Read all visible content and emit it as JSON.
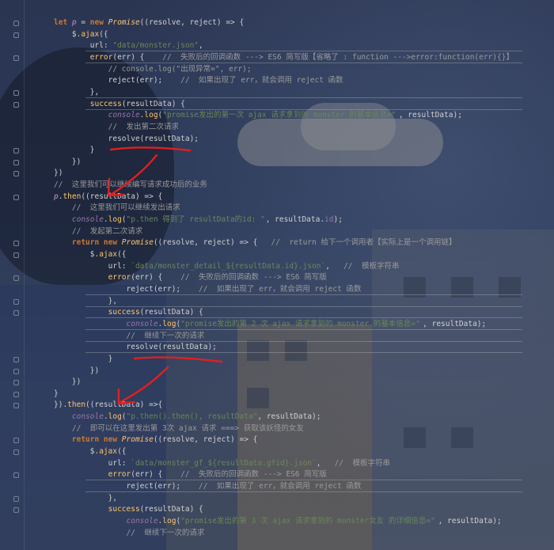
{
  "editor": {
    "lines": [
      [
        {
          "t": "let ",
          "c": "kw"
        },
        {
          "t": "p",
          "c": "var it bold"
        },
        {
          "t": " = ",
          "c": "txt"
        },
        {
          "t": "new ",
          "c": "kw"
        },
        {
          "t": "Promise",
          "c": "fn it"
        },
        {
          "t": "((resolve, reject) => {",
          "c": "txt"
        }
      ],
      [
        {
          "t": "    $",
          "c": "txt"
        },
        {
          "t": ".ajax",
          "c": "fn"
        },
        {
          "t": "({",
          "c": "txt"
        }
      ],
      [
        {
          "t": "        url: ",
          "c": "txt"
        },
        {
          "t": "\"data/monster.json\"",
          "c": "str"
        },
        {
          "t": ",",
          "c": "txt"
        }
      ],
      [
        {
          "t": "        error",
          "c": "fn"
        },
        {
          "t": "(err) {    ",
          "c": "txt"
        },
        {
          "t": "//  失败后的回调函数 ---> ES6 简写版【省略了 : function --->error:function(err){}】",
          "c": "cm"
        }
      ],
      [
        {
          "t": "            ",
          "c": "txt"
        },
        {
          "t": "// console.log(\"出现异常=\", err);",
          "c": "cm"
        }
      ],
      [
        {
          "t": "            reject(err);    ",
          "c": "txt"
        },
        {
          "t": "//  如果出现了 err，就会调用 reject 函数",
          "c": "cm"
        }
      ],
      [
        {
          "t": "        },",
          "c": "txt"
        }
      ],
      [
        {
          "t": "        success",
          "c": "fn"
        },
        {
          "t": "(resultData) {",
          "c": "txt"
        }
      ],
      [
        {
          "t": "            ",
          "c": "txt"
        },
        {
          "t": "console",
          "c": "var it"
        },
        {
          "t": ".",
          "c": "txt"
        },
        {
          "t": "log",
          "c": "fn"
        },
        {
          "t": "(",
          "c": "txt"
        },
        {
          "t": "\"promise发出的第一次 ajax 请求拿到的 monster 的基本信息=\"",
          "c": "str"
        },
        {
          "t": ", resultData);",
          "c": "txt"
        }
      ],
      [
        {
          "t": "            ",
          "c": "txt"
        },
        {
          "t": "//  发出第二次请求",
          "c": "cm"
        }
      ],
      [
        {
          "t": "            resolve(resultData);",
          "c": "txt"
        }
      ],
      [
        {
          "t": "        }",
          "c": "txt"
        }
      ],
      [
        {
          "t": "    })",
          "c": "txt"
        }
      ],
      [
        {
          "t": "})",
          "c": "txt"
        }
      ],
      [
        {
          "t": "//  这里我们可以继续编写请求成功后的业务",
          "c": "cm"
        }
      ],
      [
        {
          "t": "p",
          "c": "var it bold"
        },
        {
          "t": ".",
          "c": "txt"
        },
        {
          "t": "then",
          "c": "fn"
        },
        {
          "t": "((resultData) => {",
          "c": "txt"
        }
      ],
      [
        {
          "t": "    ",
          "c": "txt"
        },
        {
          "t": "//  这里我们可以继续发出请求",
          "c": "cm"
        }
      ],
      [
        {
          "t": "    ",
          "c": "txt"
        },
        {
          "t": "console",
          "c": "var it"
        },
        {
          "t": ".",
          "c": "txt"
        },
        {
          "t": "log",
          "c": "fn"
        },
        {
          "t": "(",
          "c": "txt"
        },
        {
          "t": "\"p.then 得到了 resultData的id: \"",
          "c": "str"
        },
        {
          "t": ", resultData.",
          "c": "txt"
        },
        {
          "t": "id",
          "c": "var"
        },
        {
          "t": ");",
          "c": "txt"
        }
      ],
      [
        {
          "t": "    ",
          "c": "txt"
        },
        {
          "t": "//  发起第二次请求",
          "c": "cm"
        }
      ],
      [
        {
          "t": "    ",
          "c": "txt"
        },
        {
          "t": "return new ",
          "c": "kw"
        },
        {
          "t": "Promise",
          "c": "fn it"
        },
        {
          "t": "((resolve, reject) => {   ",
          "c": "txt"
        },
        {
          "t": "//  return 给下一个调用者【实际上是一个调用链】",
          "c": "cm"
        }
      ],
      [
        {
          "t": "        $",
          "c": "txt"
        },
        {
          "t": ".ajax",
          "c": "fn"
        },
        {
          "t": "({",
          "c": "txt"
        }
      ],
      [
        {
          "t": "            url: ",
          "c": "txt"
        },
        {
          "t": "`data/monster_detail_${resultData.id}.json`",
          "c": "str"
        },
        {
          "t": ",   ",
          "c": "txt"
        },
        {
          "t": "//  模板字符串",
          "c": "cm"
        }
      ],
      [
        {
          "t": "            error",
          "c": "fn"
        },
        {
          "t": "(err) {    ",
          "c": "txt"
        },
        {
          "t": "//  失败后的回调函数 ---> ES6 简写版",
          "c": "cm"
        }
      ],
      [
        {
          "t": "                reject(err);    ",
          "c": "txt"
        },
        {
          "t": "//  如果出现了 err，就会调用 reject 函数",
          "c": "cm"
        }
      ],
      [
        {
          "t": "            },",
          "c": "txt"
        }
      ],
      [
        {
          "t": "            success",
          "c": "fn"
        },
        {
          "t": "(resultData) {",
          "c": "txt"
        }
      ],
      [
        {
          "t": "                ",
          "c": "txt"
        },
        {
          "t": "console",
          "c": "var it"
        },
        {
          "t": ".",
          "c": "txt"
        },
        {
          "t": "log",
          "c": "fn"
        },
        {
          "t": "(",
          "c": "txt"
        },
        {
          "t": "\"promise发出的第 2 次 ajax 请求拿到的 monster 的基本信息=\"",
          "c": "str"
        },
        {
          "t": ", resultData);",
          "c": "txt"
        }
      ],
      [
        {
          "t": "                ",
          "c": "txt"
        },
        {
          "t": "//  继续下一次的请求",
          "c": "cm"
        }
      ],
      [
        {
          "t": "                resolve(resultData);",
          "c": "txt"
        }
      ],
      [
        {
          "t": "            }",
          "c": "txt"
        }
      ],
      [
        {
          "t": "        })",
          "c": "txt"
        }
      ],
      [
        {
          "t": "    })",
          "c": "txt"
        }
      ],
      [
        {
          "t": "}",
          "c": "txt"
        }
      ],
      [
        {
          "t": "}).",
          "c": "txt"
        },
        {
          "t": "then",
          "c": "fn"
        },
        {
          "t": "((resultData) =>{",
          "c": "txt"
        }
      ],
      [
        {
          "t": "    ",
          "c": "txt"
        },
        {
          "t": "console",
          "c": "var it"
        },
        {
          "t": ".",
          "c": "txt"
        },
        {
          "t": "log",
          "c": "fn"
        },
        {
          "t": "(",
          "c": "txt"
        },
        {
          "t": "\"p.then().then(), resultData\"",
          "c": "str"
        },
        {
          "t": ", resultData);",
          "c": "txt"
        }
      ],
      [
        {
          "t": "    ",
          "c": "txt"
        },
        {
          "t": "//  即可以在这里发出第 3次 ajax 请求 ===> 获取该妖怪的女友",
          "c": "cm"
        }
      ],
      [
        {
          "t": "    ",
          "c": "txt"
        },
        {
          "t": "return new ",
          "c": "kw"
        },
        {
          "t": "Promise",
          "c": "fn it"
        },
        {
          "t": "((resolve, reject) => {",
          "c": "txt"
        }
      ],
      [
        {
          "t": "        $",
          "c": "txt"
        },
        {
          "t": ".ajax",
          "c": "fn"
        },
        {
          "t": "({",
          "c": "txt"
        }
      ],
      [
        {
          "t": "            url: ",
          "c": "txt"
        },
        {
          "t": "`data/monster_gf_${resultData.gfid}.json`",
          "c": "str"
        },
        {
          "t": ",   ",
          "c": "txt"
        },
        {
          "t": "//  模板字符串",
          "c": "cm"
        }
      ],
      [
        {
          "t": "            error",
          "c": "fn"
        },
        {
          "t": "(err) {    ",
          "c": "txt"
        },
        {
          "t": "//  失败后的回调函数 ---> ES6 简写版",
          "c": "cm"
        }
      ],
      [
        {
          "t": "                reject(err);    ",
          "c": "txt"
        },
        {
          "t": "//  如果出现了 err，就会调用 reject 函数",
          "c": "cm"
        }
      ],
      [
        {
          "t": "            },",
          "c": "txt"
        }
      ],
      [
        {
          "t": "            success",
          "c": "fn"
        },
        {
          "t": "(resultData) {",
          "c": "txt"
        }
      ],
      [
        {
          "t": "                ",
          "c": "txt"
        },
        {
          "t": "console",
          "c": "var it"
        },
        {
          "t": ".",
          "c": "txt"
        },
        {
          "t": "log",
          "c": "fn"
        },
        {
          "t": "(",
          "c": "txt"
        },
        {
          "t": "\"promise发出的第 3 次 ajax 请求拿到的 monster女友 的详细信息=\"",
          "c": "str"
        },
        {
          "t": ", resultData);",
          "c": "txt"
        }
      ],
      [
        {
          "t": "                ",
          "c": "txt"
        },
        {
          "t": "//  继续下一次的请求",
          "c": "cm"
        }
      ]
    ]
  },
  "colors": {
    "keyword": "#cc7832",
    "string": "#6a8759",
    "comment": "#9a9a9a",
    "function": "#ffc66d",
    "variable": "#9876aa",
    "annotation": "#e0201e"
  }
}
